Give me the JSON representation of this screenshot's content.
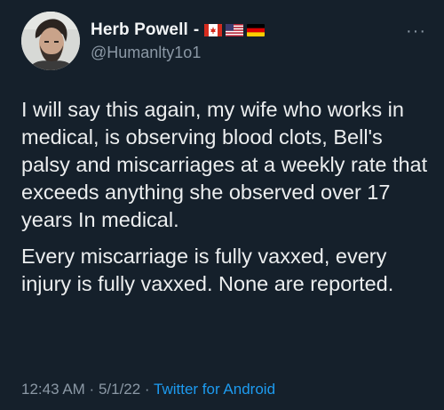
{
  "tweet": {
    "author_name": "Herb Powell",
    "separator": "-",
    "flags": [
      "canada-flag",
      "usa-flag",
      "germany-flag"
    ],
    "handle": "@Humanlty1o1",
    "more_icon": "more-dots-icon",
    "more_label": "···",
    "paragraphs": [
      "I will say this again, my wife who works in medical, is observing blood clots, Bell's palsy and miscarriages at a weekly rate that exceeds anything she observed over 17 years In medical.",
      "Every miscarriage is fully vaxxed, every injury is fully vaxxed. None are reported."
    ],
    "time": "12:43 AM",
    "dot": " · ",
    "date": "5/1/22",
    "source": "Twitter for Android"
  },
  "colors": {
    "background": "#15202b",
    "text": "#e7e9ea",
    "secondary": "#8b98a5",
    "link": "#1d9bf0"
  }
}
